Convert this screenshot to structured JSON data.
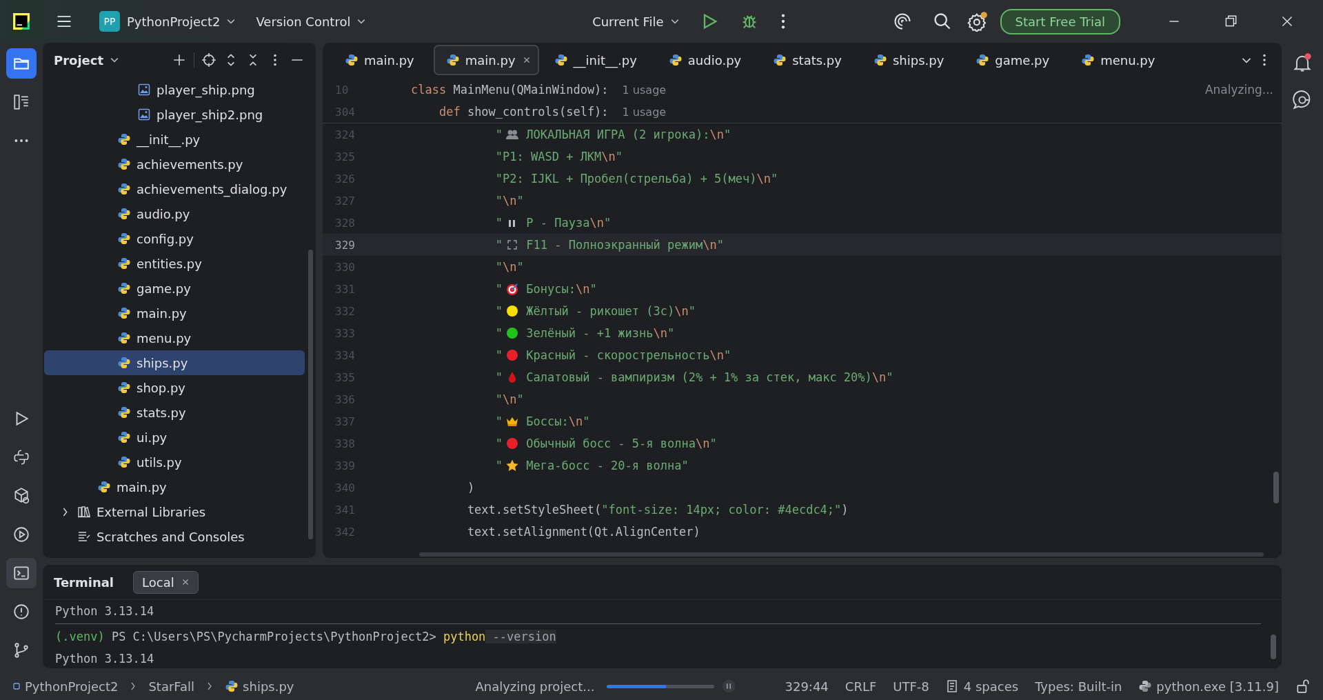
{
  "title_bar": {
    "project_badge": "PP",
    "project": "PythonProject2",
    "vcs": "Version Control",
    "run_config": "Current File",
    "trial_button": "Start Free Trial"
  },
  "tool_strip": [
    {
      "kind": "project",
      "selected": true
    },
    {
      "kind": "structure",
      "selected": false
    },
    {
      "kind": "more",
      "selected": false
    },
    {
      "kind": "run",
      "selected": false
    },
    {
      "kind": "console",
      "selected": false
    },
    {
      "kind": "packages",
      "selected": false
    },
    {
      "kind": "services",
      "selected": false
    },
    {
      "kind": "terminal",
      "selected": true
    },
    {
      "kind": "problems",
      "selected": false
    },
    {
      "kind": "git",
      "selected": false
    }
  ],
  "project_panel": {
    "title": "Project",
    "tree": [
      {
        "children": [
          {
            "children": [
              {
                "children": [
                  {
                    "label": "player_ship.png",
                    "kind": "image",
                    "selected": false
                  },
                  {
                    "label": "player_ship2.png",
                    "kind": "image",
                    "selected": false
                  }
                ]
              },
              {
                "label": "__init__.py",
                "kind": "python",
                "selected": false
              },
              {
                "label": "achievements.py",
                "kind": "python",
                "selected": false
              },
              {
                "label": "achievements_dialog.py",
                "kind": "python",
                "selected": false
              },
              {
                "label": "audio.py",
                "kind": "python",
                "selected": false
              },
              {
                "label": "config.py",
                "kind": "python",
                "selected": false
              },
              {
                "label": "entities.py",
                "kind": "python",
                "selected": false
              },
              {
                "label": "game.py",
                "kind": "python",
                "selected": false
              },
              {
                "label": "main.py",
                "kind": "python",
                "selected": false
              },
              {
                "label": "menu.py",
                "kind": "python",
                "selected": false
              },
              {
                "label": "ships.py",
                "kind": "python",
                "selected": true
              },
              {
                "label": "shop.py",
                "kind": "python",
                "selected": false
              },
              {
                "label": "stats.py",
                "kind": "python",
                "selected": false
              },
              {
                "label": "ui.py",
                "kind": "python",
                "selected": false
              },
              {
                "label": "utils.py",
                "kind": "python",
                "selected": false
              }
            ]
          },
          {
            "label": "main.py",
            "kind": "python",
            "selected": false
          }
        ]
      },
      {
        "label": "External Libraries",
        "kind": "library",
        "expanded": false,
        "selected": false
      },
      {
        "label": "Scratches and Consoles",
        "kind": "scratches",
        "selected": false
      }
    ]
  },
  "editor": {
    "tabs": [
      {
        "label": "main.py",
        "selected": false
      },
      {
        "label": "main.py",
        "selected": true
      },
      {
        "label": "__init__.py",
        "selected": false
      },
      {
        "label": "audio.py",
        "selected": false
      },
      {
        "label": "stats.py",
        "selected": false
      },
      {
        "label": "ships.py",
        "selected": false
      },
      {
        "label": "game.py",
        "selected": false
      },
      {
        "label": "menu.py",
        "selected": false
      }
    ],
    "status": "Analyzing...",
    "sticky_lines": [
      {
        "number": "10",
        "segments": [
          {
            "kind": "keyword",
            "text": "class "
          },
          {
            "kind": "plain",
            "text": "MainMenu(QMainWindow):"
          }
        ],
        "hint": "1 usage"
      },
      {
        "number": "304",
        "segments": [
          {
            "kind": "keyword",
            "text": "    def "
          },
          {
            "kind": "plain",
            "text": "show_controls(self):"
          }
        ],
        "hint": "1 usage"
      }
    ],
    "lines": [
      {
        "number": "324",
        "current": false,
        "segments": [
          {
            "kind": "string",
            "text": "            \""
          },
          {
            "kind": "people"
          },
          {
            "kind": "string",
            "text": " ЛОКАЛЬНАЯ ИГРА (2 игрока):"
          },
          {
            "kind": "escape",
            "text": "\\n"
          },
          {
            "kind": "string",
            "text": "\""
          }
        ]
      },
      {
        "number": "325",
        "current": false,
        "segments": [
          {
            "kind": "string",
            "text": "            \"P1: WASD + ЛКМ"
          },
          {
            "kind": "escape",
            "text": "\\n"
          },
          {
            "kind": "string",
            "text": "\""
          }
        ]
      },
      {
        "number": "326",
        "current": false,
        "segments": [
          {
            "kind": "string",
            "text": "            \"P2: IJKL + Пробел(стрельба) + 5(меч)"
          },
          {
            "kind": "escape",
            "text": "\\n"
          },
          {
            "kind": "string",
            "text": "\""
          }
        ]
      },
      {
        "number": "327",
        "current": false,
        "segments": [
          {
            "kind": "string",
            "text": "            \""
          },
          {
            "kind": "escape",
            "text": "\\n"
          },
          {
            "kind": "string",
            "text": "\""
          }
        ]
      },
      {
        "number": "328",
        "current": false,
        "segments": [
          {
            "kind": "string",
            "text": "            \""
          },
          {
            "kind": "pause"
          },
          {
            "kind": "string",
            "text": " P - Пауза"
          },
          {
            "kind": "escape",
            "text": "\\n"
          },
          {
            "kind": "string",
            "text": "\""
          }
        ]
      },
      {
        "number": "329",
        "current": true,
        "segments": [
          {
            "kind": "string",
            "text": "            \""
          },
          {
            "kind": "fullscreen"
          },
          {
            "kind": "string",
            "text": " F11 - Полноэкранный режим"
          },
          {
            "kind": "escape",
            "text": "\\n"
          },
          {
            "kind": "string",
            "text": "\""
          }
        ]
      },
      {
        "number": "330",
        "current": false,
        "segments": [
          {
            "kind": "string",
            "text": "            \""
          },
          {
            "kind": "escape",
            "text": "\\n"
          },
          {
            "kind": "string",
            "text": "\""
          }
        ]
      },
      {
        "number": "331",
        "current": false,
        "segments": [
          {
            "kind": "string",
            "text": "            \""
          },
          {
            "kind": "target"
          },
          {
            "kind": "string",
            "text": " Бонусы:"
          },
          {
            "kind": "escape",
            "text": "\\n"
          },
          {
            "kind": "string",
            "text": "\""
          }
        ]
      },
      {
        "number": "332",
        "current": false,
        "segments": [
          {
            "kind": "string",
            "text": "            \""
          },
          {
            "kind": "dot",
            "color": "#f5e000"
          },
          {
            "kind": "string",
            "text": " Жёлтый - рикошет (3с)"
          },
          {
            "kind": "escape",
            "text": "\\n"
          },
          {
            "kind": "string",
            "text": "\""
          }
        ]
      },
      {
        "number": "333",
        "current": false,
        "segments": [
          {
            "kind": "string",
            "text": "            \""
          },
          {
            "kind": "dot",
            "color": "#22c21d"
          },
          {
            "kind": "string",
            "text": " Зелёный - +1 жизнь"
          },
          {
            "kind": "escape",
            "text": "\\n"
          },
          {
            "kind": "string",
            "text": "\""
          }
        ]
      },
      {
        "number": "334",
        "current": false,
        "segments": [
          {
            "kind": "string",
            "text": "            \""
          },
          {
            "kind": "dot",
            "color": "#e8202a"
          },
          {
            "kind": "string",
            "text": " Красный - скорострельность"
          },
          {
            "kind": "escape",
            "text": "\\n"
          },
          {
            "kind": "string",
            "text": "\""
          }
        ]
      },
      {
        "number": "335",
        "current": false,
        "segments": [
          {
            "kind": "string",
            "text": "            \""
          },
          {
            "kind": "drop"
          },
          {
            "kind": "string",
            "text": " Салатовый - вампиризм (2% + 1% за стек, макс 20%)"
          },
          {
            "kind": "escape",
            "text": "\\n"
          },
          {
            "kind": "string",
            "text": "\""
          }
        ]
      },
      {
        "number": "336",
        "current": false,
        "segments": [
          {
            "kind": "string",
            "text": "            \""
          },
          {
            "kind": "escape",
            "text": "\\n"
          },
          {
            "kind": "string",
            "text": "\""
          }
        ]
      },
      {
        "number": "337",
        "current": false,
        "segments": [
          {
            "kind": "string",
            "text": "            \""
          },
          {
            "kind": "crown"
          },
          {
            "kind": "string",
            "text": " Боссы:"
          },
          {
            "kind": "escape",
            "text": "\\n"
          },
          {
            "kind": "string",
            "text": "\""
          }
        ]
      },
      {
        "number": "338",
        "current": false,
        "segments": [
          {
            "kind": "string",
            "text": "            \""
          },
          {
            "kind": "dot",
            "color": "#e8202a"
          },
          {
            "kind": "string",
            "text": " Обычный босс - 5-я волна"
          },
          {
            "kind": "escape",
            "text": "\\n"
          },
          {
            "kind": "string",
            "text": "\""
          }
        ]
      },
      {
        "number": "339",
        "current": false,
        "segments": [
          {
            "kind": "string",
            "text": "            \""
          },
          {
            "kind": "star"
          },
          {
            "kind": "string",
            "text": " Мега-босс - 20-я волна\""
          }
        ]
      },
      {
        "number": "340",
        "current": false,
        "segments": [
          {
            "kind": "plain",
            "text": "        )"
          }
        ]
      },
      {
        "number": "341",
        "current": false,
        "segments": [
          {
            "kind": "plain",
            "text": "        text.setStyleSheet("
          },
          {
            "kind": "string",
            "text": "\"font-size: 14px; color: #4ecdc4;\""
          },
          {
            "kind": "plain",
            "text": ")"
          }
        ]
      },
      {
        "number": "342",
        "current": false,
        "segments": [
          {
            "kind": "plain",
            "text": "        text.setAlignment(Qt.AlignCenter)"
          }
        ]
      }
    ]
  },
  "terminal": {
    "title": "Terminal",
    "tabs": [
      {
        "label": "Local",
        "selected": true
      }
    ],
    "output": [
      {
        "segments": [
          {
            "kind": "plain",
            "text": "Python 3.13.14"
          }
        ]
      },
      {
        "segments": [
          {
            "kind": "env",
            "text": "(.venv)"
          },
          {
            "kind": "plain",
            "text": " PS C:\\Users\\PS\\PycharmProjects\\PythonProject2> "
          },
          {
            "kind": "command",
            "text": "python"
          },
          {
            "kind": "option",
            "text": " --version"
          }
        ],
        "divider_above": true
      },
      {
        "segments": [
          {
            "kind": "plain",
            "text": "Python 3.13.14"
          }
        ]
      }
    ]
  },
  "status_bar": {
    "breadcrumbs": [
      {
        "label": "PythonProject2",
        "kind": "module"
      },
      {
        "label": "StarFall",
        "kind": "folder"
      },
      {
        "label": "ships.py",
        "kind": "python"
      }
    ],
    "task": "Analyzing project...",
    "level": 0.55,
    "items": [
      "329:44",
      "CRLF",
      "UTF-8",
      "4 spaces",
      "Types: Built-in",
      "python.exe [3.11.9]"
    ]
  }
}
